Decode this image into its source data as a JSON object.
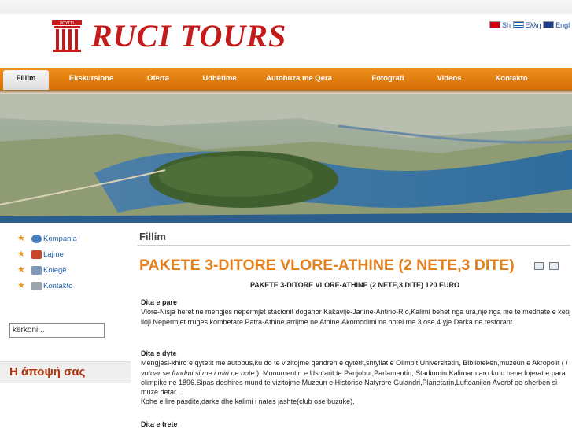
{
  "header": {
    "brand": "RUCI  TOURS",
    "languages": [
      {
        "flag": "albanian-flag",
        "label": "Shqip"
      },
      {
        "flag": "greek-flag",
        "label": "Ελληνικά"
      },
      {
        "flag": "english-flag",
        "label": "English"
      }
    ],
    "lang_text": [
      "Sh",
      "Ελλη",
      "Engl"
    ]
  },
  "colors": {
    "nav": "#e27d12",
    "title": "#e6801c",
    "brand": "#c41a1a",
    "link": "#1f5fa8"
  },
  "nav": {
    "items": [
      {
        "label": "Fillim",
        "active": true
      },
      {
        "label": "Ekskursione"
      },
      {
        "label": "Oferta"
      },
      {
        "label": "Udhëtime"
      },
      {
        "label": "Autobuza me Qera"
      },
      {
        "label": "Fotografi"
      },
      {
        "label": "Videos"
      },
      {
        "label": "Kontakto"
      }
    ]
  },
  "sidebar": {
    "menu": [
      {
        "label": "Kompania",
        "icon": "globe-icon"
      },
      {
        "label": "Lajme",
        "icon": "news-icon"
      },
      {
        "label": "Kolegë",
        "icon": "people-icon"
      },
      {
        "label": "Kontakto",
        "icon": "contact-icon"
      }
    ],
    "search_value": "kërkoni...",
    "poll_title": "Η άποψή σας"
  },
  "main": {
    "breadcrumb": "Fillim",
    "title": "PAKETE 3-DITORE VLORE-ATHINE (2 NETE,3 DITE)",
    "subtitle": "PAKETE 3-DITORE  VLORE-ATHINE (2 NETE,3 DITE)   120 EURO",
    "day1_head": "Dita e pare",
    "day1_text": "Vlore-Nisja heret ne mengjes nepermjet stacionit doganor Kakavije-Janine-Antirio-Rio,Kalimi behet nga ura,nje nga me te medhate e ketij lloji.Nepermjet rruges kombetare Patra-Athine arrijme ne Athine.Akomodimi ne hotel me 3 ose 4 yje.Darka ne restorant.",
    "day2_head": "Dita e dyte",
    "day2_text_a": "Mengjesi-xhiro e qytetit me autobus,ku do te vizitojme qendren e qytetit,shtyllat e Olimpit,Universitetin, Biblioteken,muzeun e Akropolit ( ",
    "day2_italic": "i votuar se fundmi si me i miri ne bote",
    "day2_text_b": " ), Monumentin e Ushtarit te Panjohur,Parlamentin, Stadiumin Kalimarmaro ku u bene lojerat e para olimpike ne 1896.Sipas deshires mund te vizitojme Muzeun e Historise Natyrore Gulandri,Planetarin,Lufteanijen Averof qe sherben si muze detar.",
    "day2_text_c": "Kohe e lire pasdite,darke dhe kalimi i nates jashte(club ose buzuke).",
    "day3_head": "Dita e trete"
  }
}
